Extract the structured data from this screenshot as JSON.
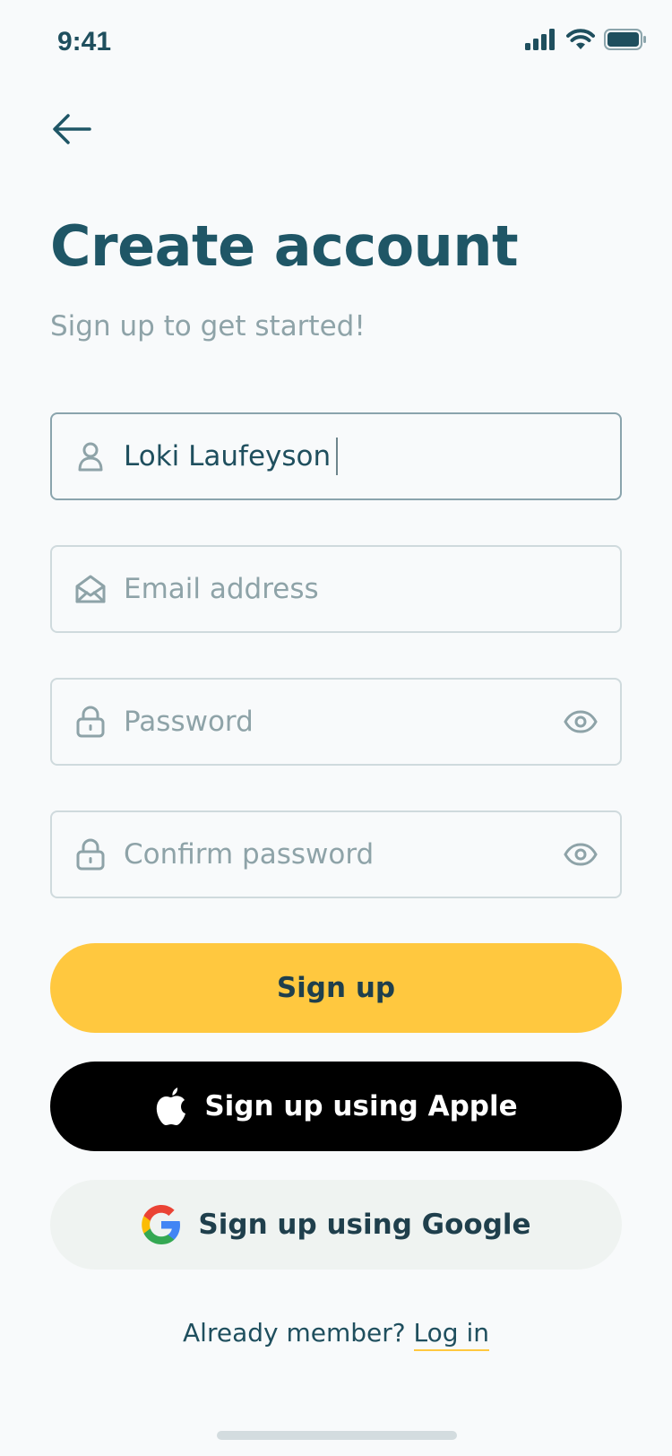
{
  "status_bar": {
    "time": "9:41"
  },
  "header": {
    "title": "Create account",
    "subtitle": "Sign up to get started!"
  },
  "form": {
    "name": {
      "value": "Loki Laufeyson",
      "icon": "user-icon"
    },
    "email": {
      "placeholder": "Email address",
      "icon": "envelope-icon"
    },
    "password": {
      "placeholder": "Password",
      "icon": "lock-icon"
    },
    "confirm_password": {
      "placeholder": "Confirm password",
      "icon": "lock-icon"
    }
  },
  "buttons": {
    "signup": "Sign up",
    "apple": "Sign up using Apple",
    "google": "Sign up using Google"
  },
  "footer": {
    "prompt": "Already member?",
    "link": "Log in"
  },
  "colors": {
    "accent": "#ffc83f",
    "text": "#1f4f5e",
    "placeholder": "#8ea3a8",
    "apple": "#000000"
  }
}
